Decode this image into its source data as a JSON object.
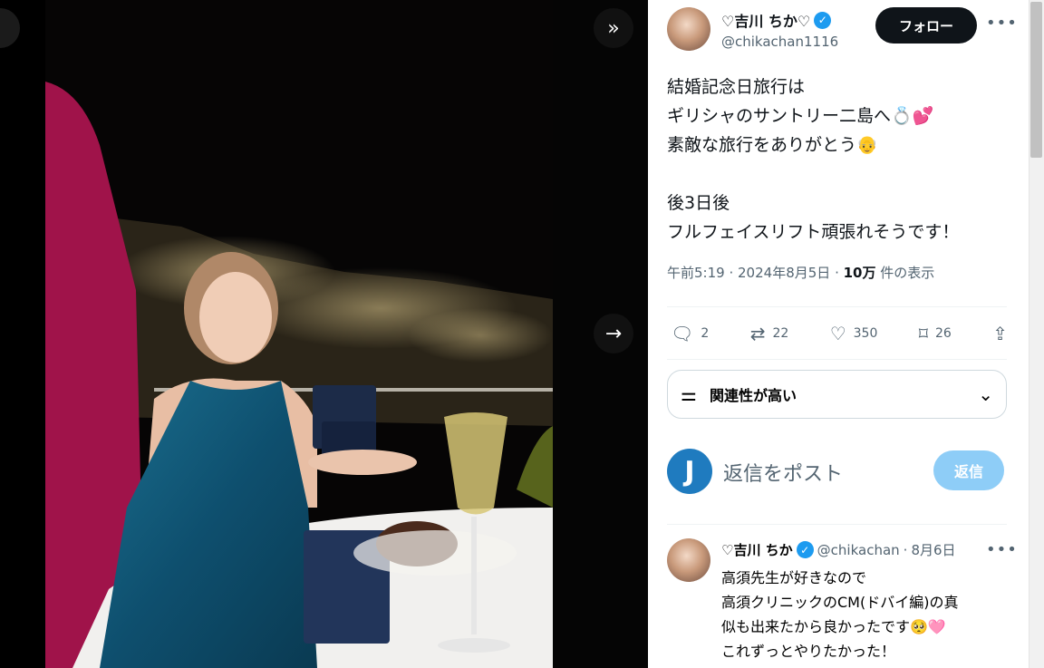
{
  "media": {
    "expand_icon": "double-chevron-right-icon",
    "next_icon": "arrow-right-icon"
  },
  "author": {
    "name": "♡吉川 ちか♡",
    "handle": "@chikachan1116",
    "verified_icon": "verified-badge-icon",
    "follow_label": "フォロー",
    "more_icon": "more-horizontal-icon"
  },
  "tweet": {
    "text": "結婚記念日旅行は\nギリシャのサントリー二島へ💍💕\n素敵な旅行をありがとう👴\n\n後3日後\nフルフェイスリフト頑張れそうです！",
    "time": "午前5:19",
    "date": "2024年8月5日",
    "views_count": "10万",
    "views_label": "件の表示"
  },
  "actions": {
    "reply": "2",
    "retweet": "22",
    "like": "350",
    "bookmark": "26"
  },
  "relevance": {
    "label": "関連性が高い",
    "icon": "sliders-icon"
  },
  "composer": {
    "avatar_letter": "J",
    "placeholder": "返信をポスト",
    "reply_label": "返信"
  },
  "reply": {
    "name": "♡吉川 ちか",
    "handle": "@chikachan",
    "date": "8月6日",
    "text": "高須先生が好きなので\n高須クリニックのCM(ドバイ編)の真\n似も出来たから良かったです🥺🩷\nこれずっとやりたかった！"
  },
  "colors": {
    "accent": "#1d9bf0",
    "reply_button": "#8ecdf7",
    "text_secondary": "#536471"
  }
}
